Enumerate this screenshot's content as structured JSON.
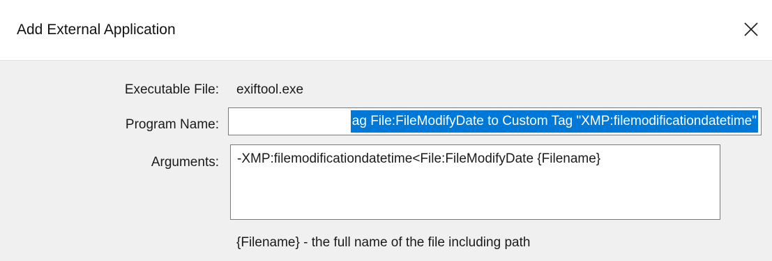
{
  "window": {
    "title": "Add External Application",
    "close_icon": "close-icon"
  },
  "form": {
    "executable_label": "Executable File:",
    "executable_value": "exiftool.exe",
    "program_name_label": "Program Name:",
    "program_name_visible_value": "ag File:FileModifyDate to Custom Tag \"XMP:filemodificationdatetime\"",
    "arguments_label": "Arguments:",
    "arguments_value": "-XMP:filemodificationdatetime<File:FileModifyDate {Filename}",
    "hint": "{Filename} - the full name of the file including path"
  },
  "colors": {
    "selection": "#0078d7",
    "background": "#f0f0f0",
    "titlebar": "#ffffff"
  }
}
